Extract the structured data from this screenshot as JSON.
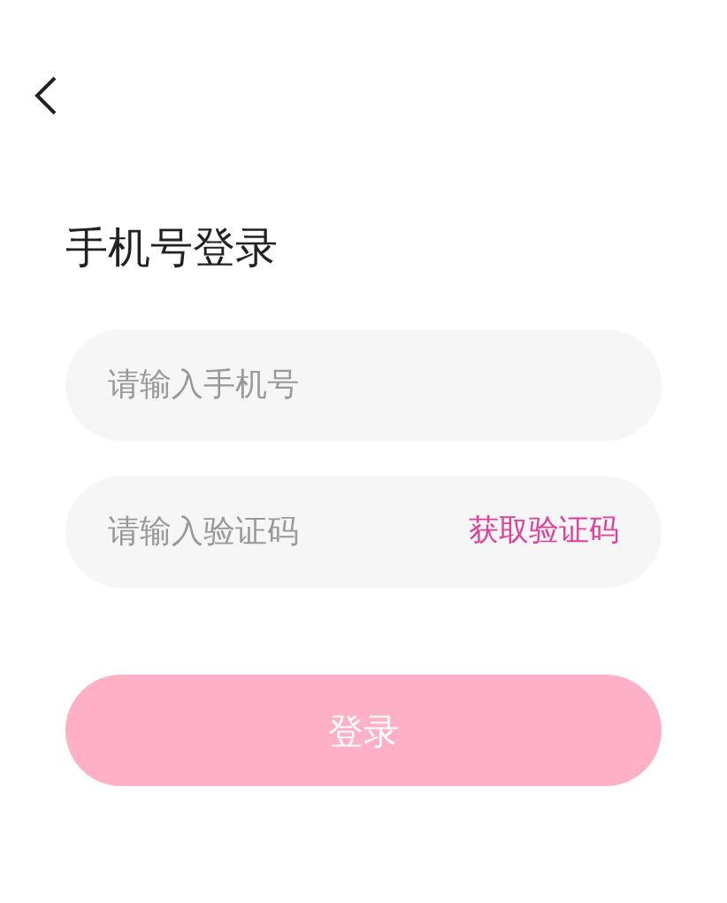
{
  "title": "手机号登录",
  "phone_field": {
    "placeholder": "请输入手机号"
  },
  "code_field": {
    "placeholder": "请输入验证码",
    "action": "获取验证码"
  },
  "login_button": {
    "label": "登录",
    "disabled": true
  }
}
